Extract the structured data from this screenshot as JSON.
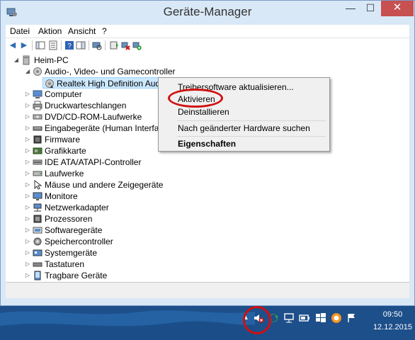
{
  "window": {
    "title": "Geräte-Manager"
  },
  "menu": [
    "Datei",
    "Aktion",
    "Ansicht",
    "?"
  ],
  "tree": {
    "root": "Heim-PC",
    "audio_category": "Audio-, Video- und Gamecontroller",
    "selected_device": "Realtek High Definition Audio",
    "categories": [
      "Computer",
      "Druckwarteschlangen",
      "DVD/CD-ROM-Laufwerke",
      "Eingabegeräte (Human Interface",
      "Firmware",
      "Grafikkarte",
      "IDE ATA/ATAPI-Controller",
      "Laufwerke",
      "Mäuse und andere Zeigegeräte",
      "Monitore",
      "Netzwerkadapter",
      "Prozessoren",
      "Softwaregeräte",
      "Speichercontroller",
      "Systemgeräte",
      "Tastaturen",
      "Tragbare Geräte"
    ]
  },
  "context_menu": {
    "update_driver": "Treibersoftware aktualisieren...",
    "activate": "Aktivieren",
    "uninstall": "Deinstallieren",
    "scan_hardware": "Nach geänderter Hardware suchen",
    "properties": "Eigenschaften"
  },
  "taskbar": {
    "time": "09:50",
    "date": "12.12.2015"
  },
  "colors": {
    "highlight_ring": "#d01010",
    "selection": "#cce8ff",
    "taskbar": "#1d4f8a"
  }
}
